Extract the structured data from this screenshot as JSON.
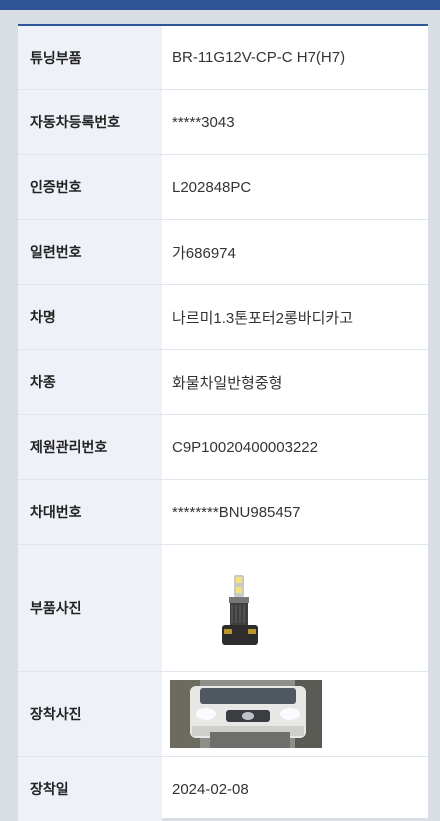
{
  "rows": [
    {
      "label": "튜닝부품",
      "value": "BR-11G12V-CP-C H7(H7)"
    },
    {
      "label": "자동차등록번호",
      "value": "*****3043"
    },
    {
      "label": "인증번호",
      "value": "L202848PC"
    },
    {
      "label": "일련번호",
      "value": "가686974"
    },
    {
      "label": "차명",
      "value": "나르미1.3톤포터2롱바디카고"
    },
    {
      "label": "차종",
      "value": "화물차일반형중형"
    },
    {
      "label": "제원관리번호",
      "value": "C9P10020400003222"
    },
    {
      "label": "차대번호",
      "value": "********BNU985457"
    },
    {
      "label": "부품사진",
      "image": "led-headlight-bulb-photo"
    },
    {
      "label": "장착사진",
      "image": "truck-front-installation-photo"
    },
    {
      "label": "장착일",
      "value": "2024-02-08"
    }
  ],
  "colors": {
    "accent": "#2f5597",
    "label_bg": "#eef1f7",
    "page_bg": "#d9dde4"
  }
}
